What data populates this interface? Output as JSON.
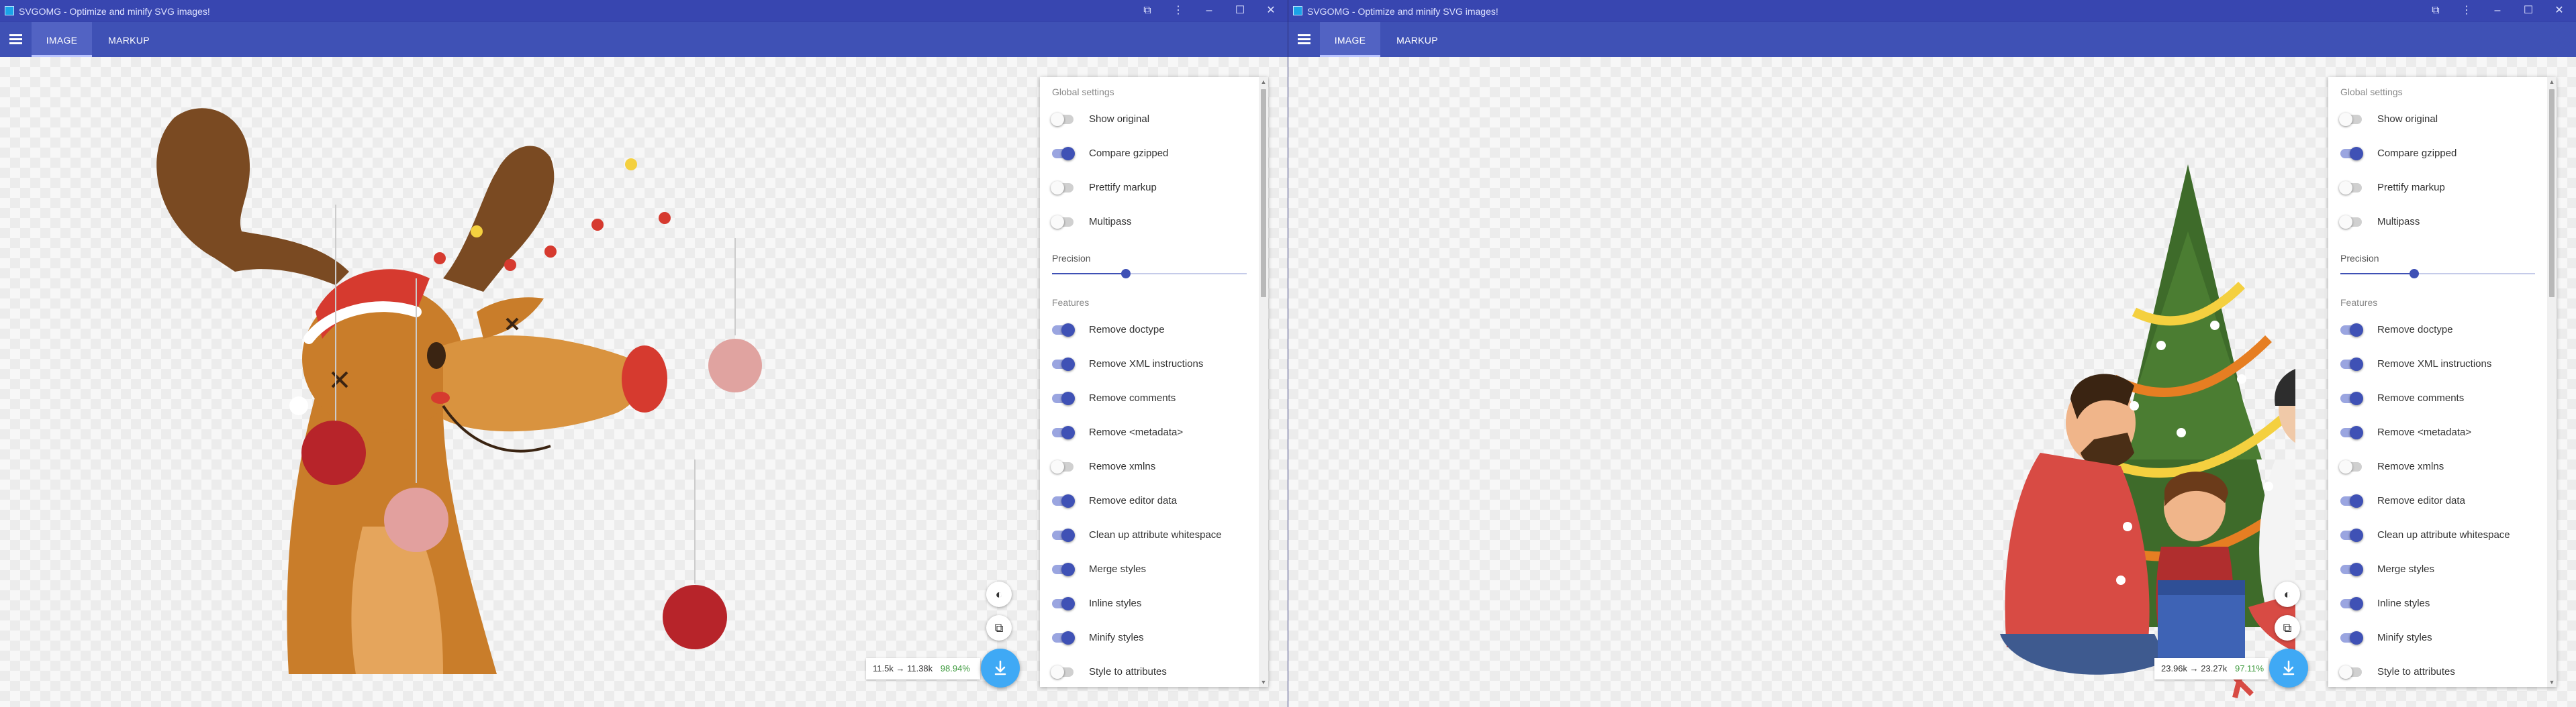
{
  "windows": [
    {
      "id": "left",
      "title": "SVGOMG - Optimize and minify SVG images!",
      "tabs": [
        {
          "label": "IMAGE",
          "active": true
        },
        {
          "label": "MARKUP",
          "active": false
        }
      ],
      "stats": {
        "original": "11.5k",
        "optimized": "11.38k",
        "arrow": "→",
        "percent": "98.94%"
      },
      "illustration": "reindeer"
    },
    {
      "id": "right",
      "title": "SVGOMG - Optimize and minify SVG images!",
      "tabs": [
        {
          "label": "IMAGE",
          "active": true
        },
        {
          "label": "MARKUP",
          "active": false
        }
      ],
      "stats": {
        "original": "23.96k",
        "optimized": "23.27k",
        "arrow": "→",
        "percent": "97.11%"
      },
      "illustration": "family-christmas-tree"
    }
  ],
  "settings": {
    "global_heading": "Global settings",
    "global": [
      {
        "label": "Show original",
        "on": false
      },
      {
        "label": "Compare gzipped",
        "on": true
      },
      {
        "label": "Prettify markup",
        "on": false
      },
      {
        "label": "Multipass",
        "on": false
      }
    ],
    "precision_label": "Precision",
    "precision_fraction": 0.38,
    "features_heading": "Features",
    "features": [
      {
        "label": "Remove doctype",
        "on": true
      },
      {
        "label": "Remove XML instructions",
        "on": true
      },
      {
        "label": "Remove comments",
        "on": true
      },
      {
        "label": "Remove <metadata>",
        "on": true
      },
      {
        "label": "Remove xmlns",
        "on": false
      },
      {
        "label": "Remove editor data",
        "on": true
      },
      {
        "label": "Clean up attribute whitespace",
        "on": true
      },
      {
        "label": "Merge styles",
        "on": true
      },
      {
        "label": "Inline styles",
        "on": true
      },
      {
        "label": "Minify styles",
        "on": true
      },
      {
        "label": "Style to attributes",
        "on": false
      }
    ]
  },
  "icons": {
    "menu": "hamburger-menu-icon",
    "theme": "theme-toggle-icon",
    "copy": "copy-icon",
    "download": "download-icon",
    "window_controls": [
      "restore-icon",
      "more-vertical-icon",
      "minimize-icon",
      "maximize-icon",
      "close-icon"
    ]
  },
  "colors": {
    "titlebar": "#3846b0",
    "appbar": "#3f51b5",
    "accent": "#3fa9f5",
    "toggle_on": "#3f51b5",
    "percent": "#3d9a3d"
  }
}
